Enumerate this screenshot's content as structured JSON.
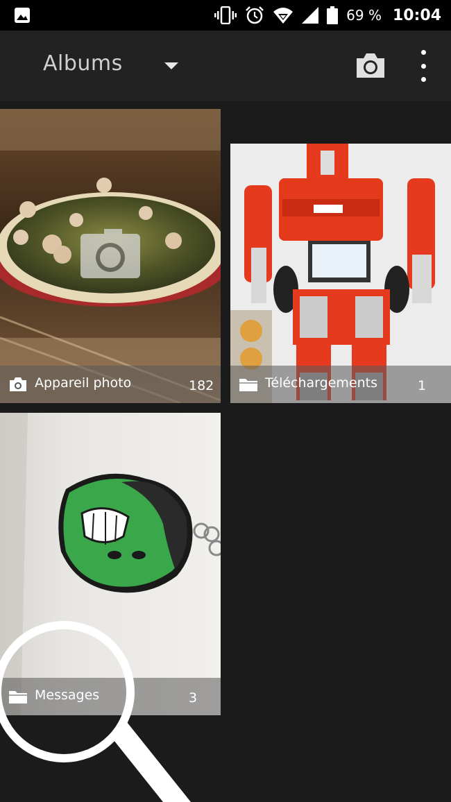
{
  "status_bar": {
    "battery_text": "69 %",
    "time": "10:04",
    "icons": [
      "image-notification-icon",
      "vibrate-icon",
      "alarm-icon",
      "wifi-icon",
      "signal-icon",
      "battery-icon"
    ]
  },
  "app_bar": {
    "title": "Albums",
    "icons": [
      "dropdown-arrow-icon",
      "camera-icon",
      "more-options-icon"
    ]
  },
  "albums": [
    {
      "name": "Appareil photo",
      "count": "182",
      "icon": "camera-icon"
    },
    {
      "name": "Téléchargements",
      "count": "1",
      "icon": "folder-icon"
    },
    {
      "name": "Messages",
      "count": "3",
      "icon": "folder-icon"
    }
  ],
  "colors": {
    "background": "#1b1b1b",
    "app_bar": "#222222",
    "status_bar": "#000000"
  }
}
